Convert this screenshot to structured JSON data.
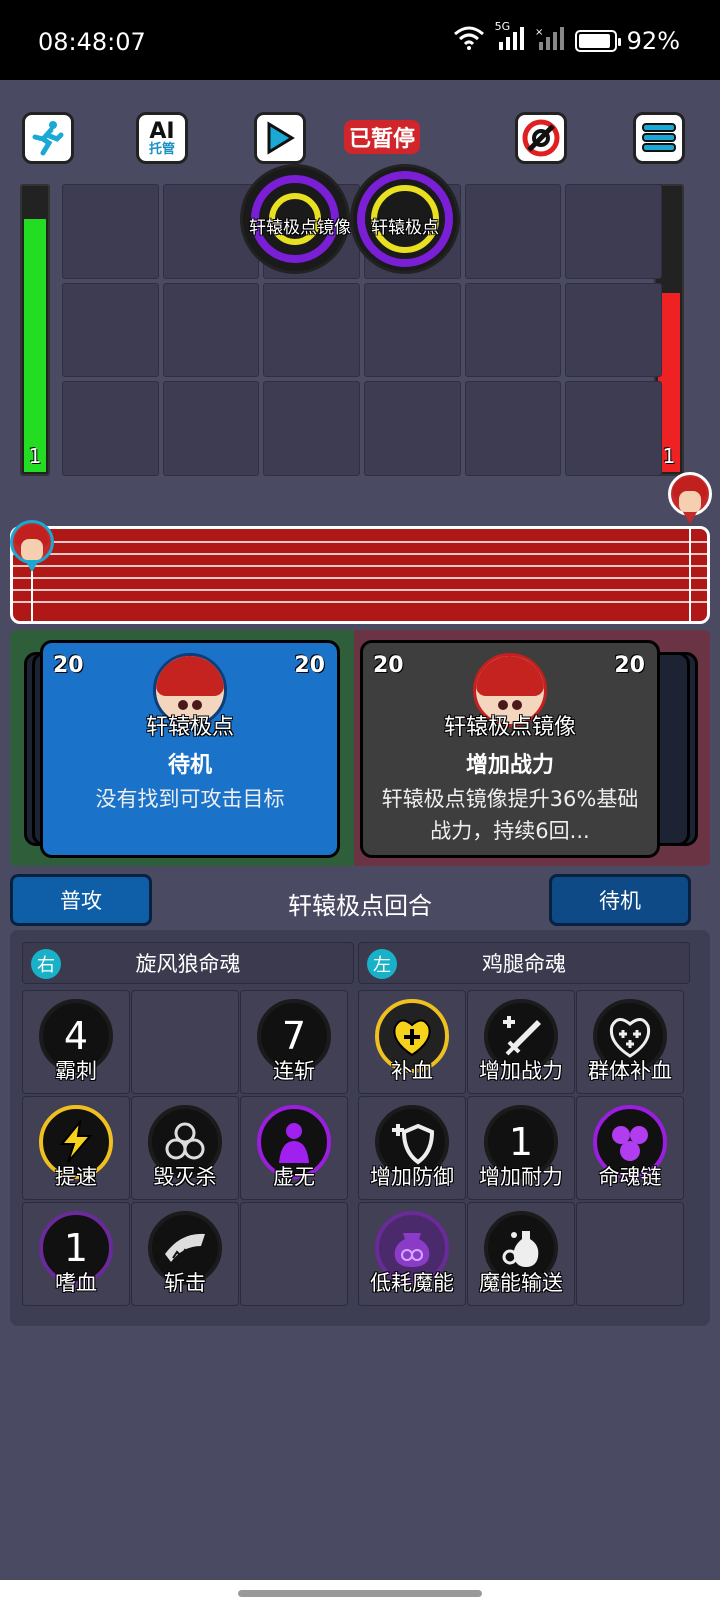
{
  "status_bar": {
    "time": "08:48:07",
    "network": "5G",
    "battery_text": "92%",
    "battery_level": 0.92
  },
  "toolbar": {
    "auto_run_icon": "running-man-icon",
    "ai_label": "AI",
    "ai_sub_label": "托管",
    "play_icon": "play-icon",
    "paused_label": "已暂停",
    "target_icon": "target-icon",
    "menu_icon": "menu-icon"
  },
  "battlefield": {
    "left_hp": {
      "value": "1",
      "level": 0.88,
      "color": "#22dd22"
    },
    "right_hp": {
      "value": "1",
      "level": 0.62,
      "color": "#ee2222"
    },
    "units": [
      {
        "label": "轩辕极点镜像"
      },
      {
        "label": "轩辕极点"
      }
    ]
  },
  "cards": {
    "left": {
      "count_left": "20",
      "count_right": "20",
      "name": "轩辕极点",
      "action": "待机",
      "desc": "没有找到可攻击目标"
    },
    "right": {
      "count_left": "20",
      "count_right": "20",
      "name": "轩辕极点镜像",
      "action": "增加战力",
      "desc": "轩辕极点镜像提升36%基础战力，持续6回..."
    }
  },
  "controls": {
    "attack_label": "普攻",
    "round_label": "轩辕极点回合",
    "standby_label": "待机"
  },
  "skills": {
    "left_group": {
      "tag": "右",
      "title": "旋风狼命魂",
      "items": [
        {
          "name": "霸刺",
          "badge": "4",
          "icon": "spike-icon"
        },
        {
          "name": "",
          "badge": "",
          "icon": ""
        },
        {
          "name": "连斩",
          "badge": "7",
          "icon": "slash-icon"
        },
        {
          "name": "提速",
          "badge": "",
          "icon": "lightning-icon"
        },
        {
          "name": "毁灭杀",
          "badge": "",
          "icon": "triple-swirl-icon"
        },
        {
          "name": "虚无",
          "badge": "",
          "icon": "void-figure-icon"
        },
        {
          "name": "嗜血",
          "badge": "1",
          "icon": "claw-icon"
        },
        {
          "name": "斩击",
          "badge": "",
          "icon": "jaw-icon"
        },
        {
          "name": "",
          "badge": "",
          "icon": ""
        }
      ]
    },
    "right_group": {
      "tag": "左",
      "title": "鸡腿命魂",
      "items": [
        {
          "name": "补血",
          "badge": "",
          "icon": "heal-icon"
        },
        {
          "name": "增加战力",
          "badge": "",
          "icon": "sword-plus-icon"
        },
        {
          "name": "群体补血",
          "badge": "",
          "icon": "group-heal-icon"
        },
        {
          "name": "增加防御",
          "badge": "",
          "icon": "shield-plus-icon"
        },
        {
          "name": "增加耐力",
          "badge": "1",
          "icon": "battery-plus-icon"
        },
        {
          "name": "命魂链",
          "badge": "",
          "icon": "soul-chain-icon"
        },
        {
          "name": "低耗魔能",
          "badge": "",
          "icon": "magic-pot-icon"
        },
        {
          "name": "魔能输送",
          "badge": "",
          "icon": "potion-icon"
        },
        {
          "name": "",
          "badge": "",
          "icon": ""
        }
      ]
    }
  }
}
